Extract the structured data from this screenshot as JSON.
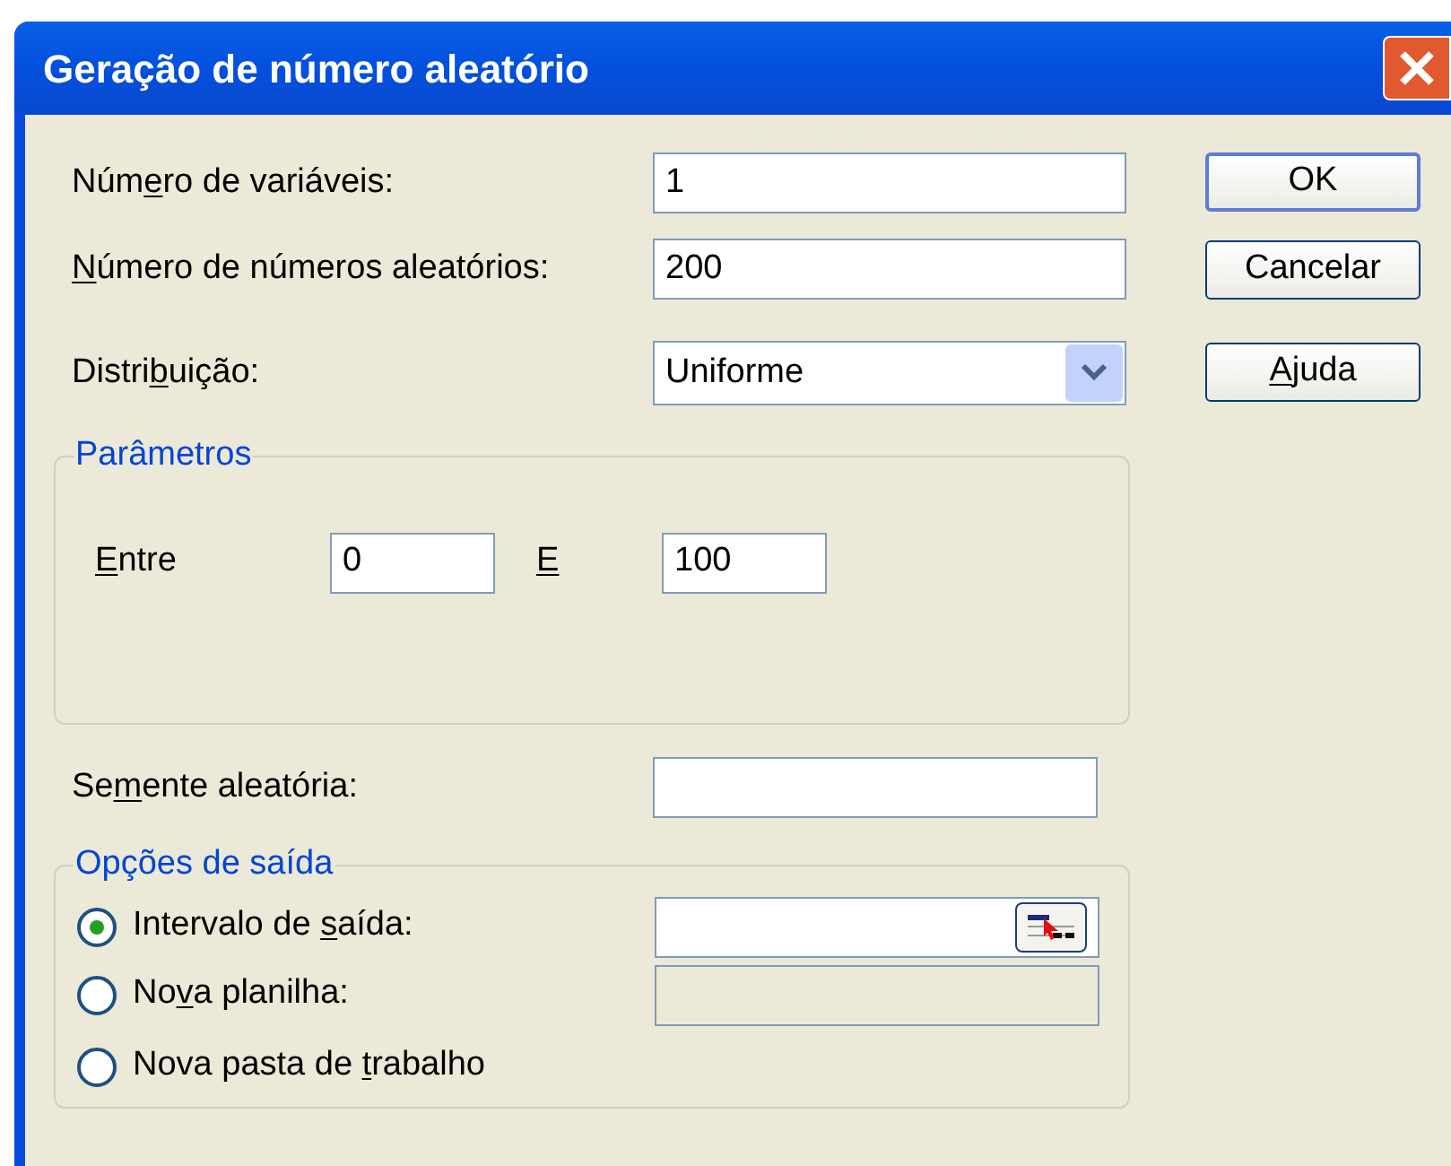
{
  "window": {
    "title": "Geração de número aleatório"
  },
  "fields": [
    {
      "label": {
        "pre": "Núm",
        "key": "e",
        "post": "ro de variáveis:"
      },
      "value": "1"
    },
    {
      "label": {
        "key": "N",
        "post": "úmero de números aleatórios:"
      },
      "value": "200"
    }
  ],
  "distribution": {
    "label": {
      "pre": "Distri",
      "key": "b",
      "post": "uição:"
    },
    "value": "Uniforme"
  },
  "parameters": {
    "title": "Parâmetros",
    "from": {
      "label": {
        "key": "E",
        "post": "ntre"
      },
      "value": "0"
    },
    "to": {
      "label": {
        "key": "E"
      },
      "value": "100"
    }
  },
  "seed": {
    "label": {
      "pre": "Se",
      "key": "m",
      "post": "ente aleatória:"
    }
  },
  "output": {
    "title": "Opções de saída",
    "options": [
      {
        "label": {
          "pre": "Intervalo de ",
          "key": "s",
          "post": "aída:"
        },
        "selected": true,
        "field": {
          "disabled": false,
          "ref_button": true
        }
      },
      {
        "label": {
          "pre": "No",
          "key": "v",
          "post": "a planilha:"
        },
        "selected": false,
        "field": {
          "disabled": true,
          "ref_button": false
        }
      },
      {
        "label": {
          "pre": "Nova pasta de ",
          "key": "t",
          "post": "rabalho"
        },
        "selected": false
      }
    ]
  },
  "buttons": [
    {
      "label": {
        "pre": "OK"
      },
      "default": true
    },
    {
      "label": {
        "pre": "Cancelar"
      },
      "default": false
    },
    {
      "label": {
        "key": "A",
        "post": "juda"
      },
      "default": false
    }
  ]
}
